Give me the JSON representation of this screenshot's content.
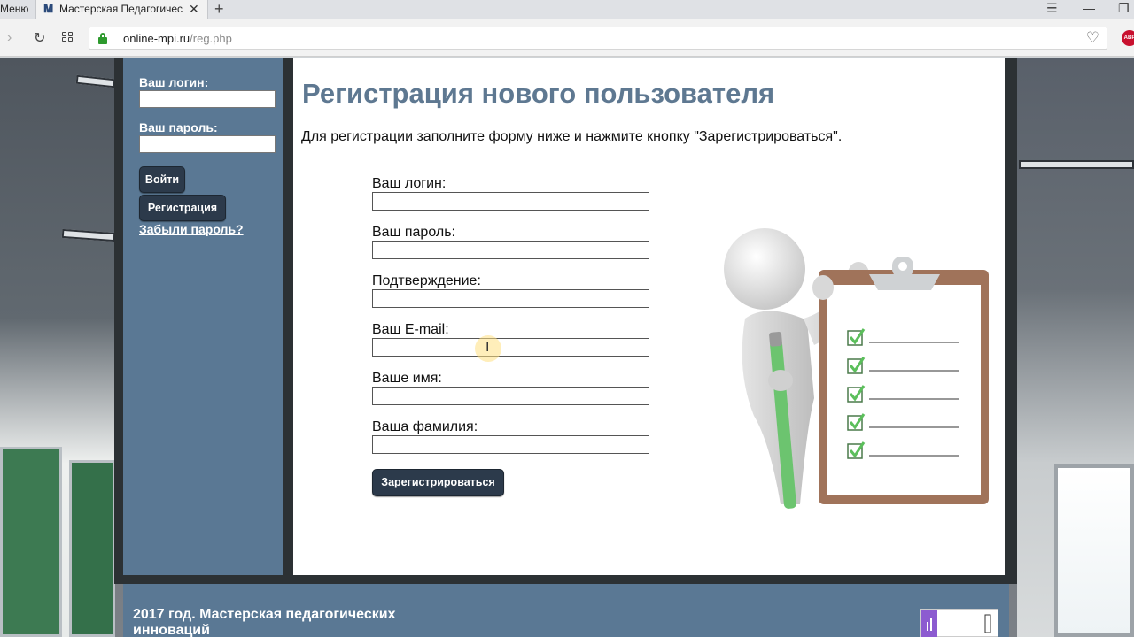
{
  "browser": {
    "prev_tab_label": "Меню",
    "tab_title": "Мастерская Педагогических",
    "tab_close": "✕",
    "new_tab": "+",
    "url_host": "online-mpi.ru",
    "url_path": "/reg.php"
  },
  "sidebar": {
    "login_label": "Ваш логин:",
    "password_label": "Ваш пароль:",
    "login_button": "Войти",
    "register_button": "Регистрация",
    "forgot_link": "Забыли пароль?"
  },
  "main": {
    "title": "Регистрация нового пользователя",
    "intro": "Для регистрации заполните форму ниже и нажмите кнопку \"Зарегистрироваться\".",
    "fields": [
      {
        "label": "Ваш логин:",
        "value": ""
      },
      {
        "label": "Ваш пароль:",
        "value": ""
      },
      {
        "label": "Подтверждение:",
        "value": ""
      },
      {
        "label": "Ваш E-mail:",
        "value": ""
      },
      {
        "label": "Ваше имя:",
        "value": ""
      },
      {
        "label": "Ваша фамилия:",
        "value": ""
      }
    ],
    "submit_button": "Зарегистрироваться"
  },
  "footer": {
    "text": "2017 год. Мастерская педагогических инноваций"
  },
  "colors": {
    "accent": "#5a7894",
    "title": "#5e7891",
    "button": "#2c3a4b",
    "check": "#5bbf5b",
    "pen": "#6cc46f"
  }
}
